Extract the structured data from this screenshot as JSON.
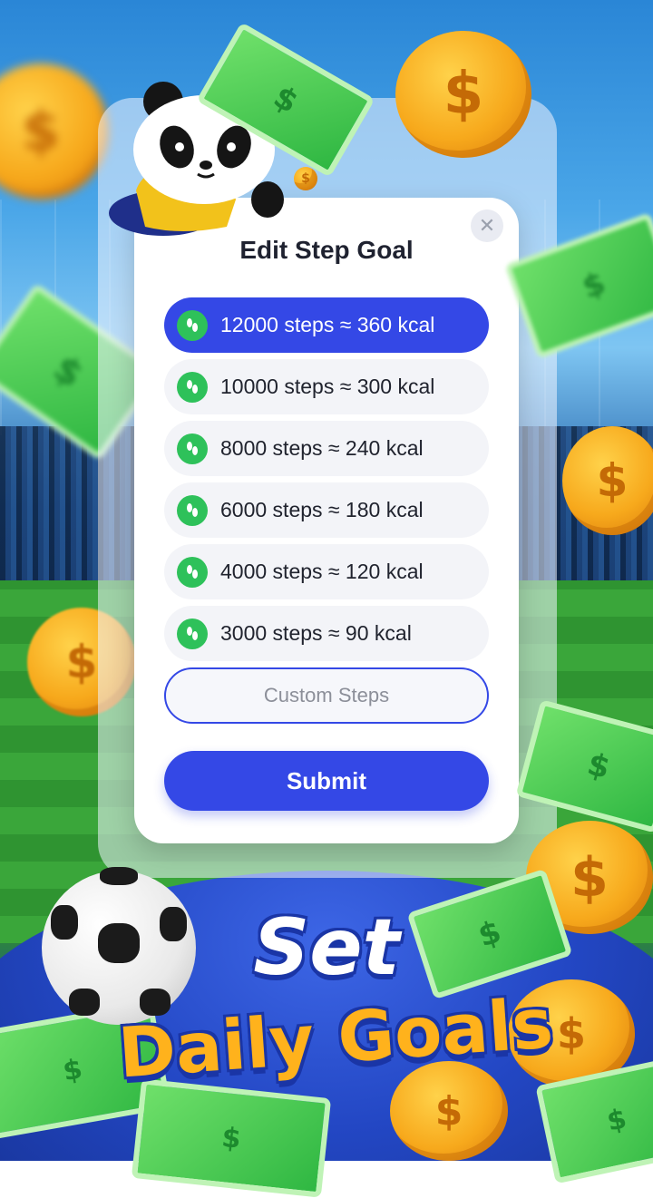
{
  "dialog": {
    "title": "Edit Step Goal",
    "close_icon": "close-icon",
    "options": [
      {
        "label": "12000 steps ≈ 360 kcal",
        "selected": true
      },
      {
        "label": "10000 steps ≈ 300 kcal",
        "selected": false
      },
      {
        "label": "8000 steps ≈ 240 kcal",
        "selected": false
      },
      {
        "label": "6000 steps ≈ 180 kcal",
        "selected": false
      },
      {
        "label": "4000 steps ≈ 120 kcal",
        "selected": false
      },
      {
        "label": "3000 steps ≈ 90 kcal",
        "selected": false
      }
    ],
    "option_icon": "footprints-icon",
    "custom_placeholder": "Custom Steps",
    "custom_value": "",
    "submit_label": "Submit"
  },
  "promo": {
    "line1": "Set",
    "line2": "Daily Goals"
  },
  "decor": {
    "mascot": "panda-mascot",
    "ball": "soccer-ball",
    "coin_symbol": "$",
    "bill_symbol": "$"
  },
  "colors": {
    "accent": "#3448e6",
    "icon_green": "#2ec15a",
    "option_bg": "#f3f4f8",
    "headline_orange": "#ffb21c"
  }
}
